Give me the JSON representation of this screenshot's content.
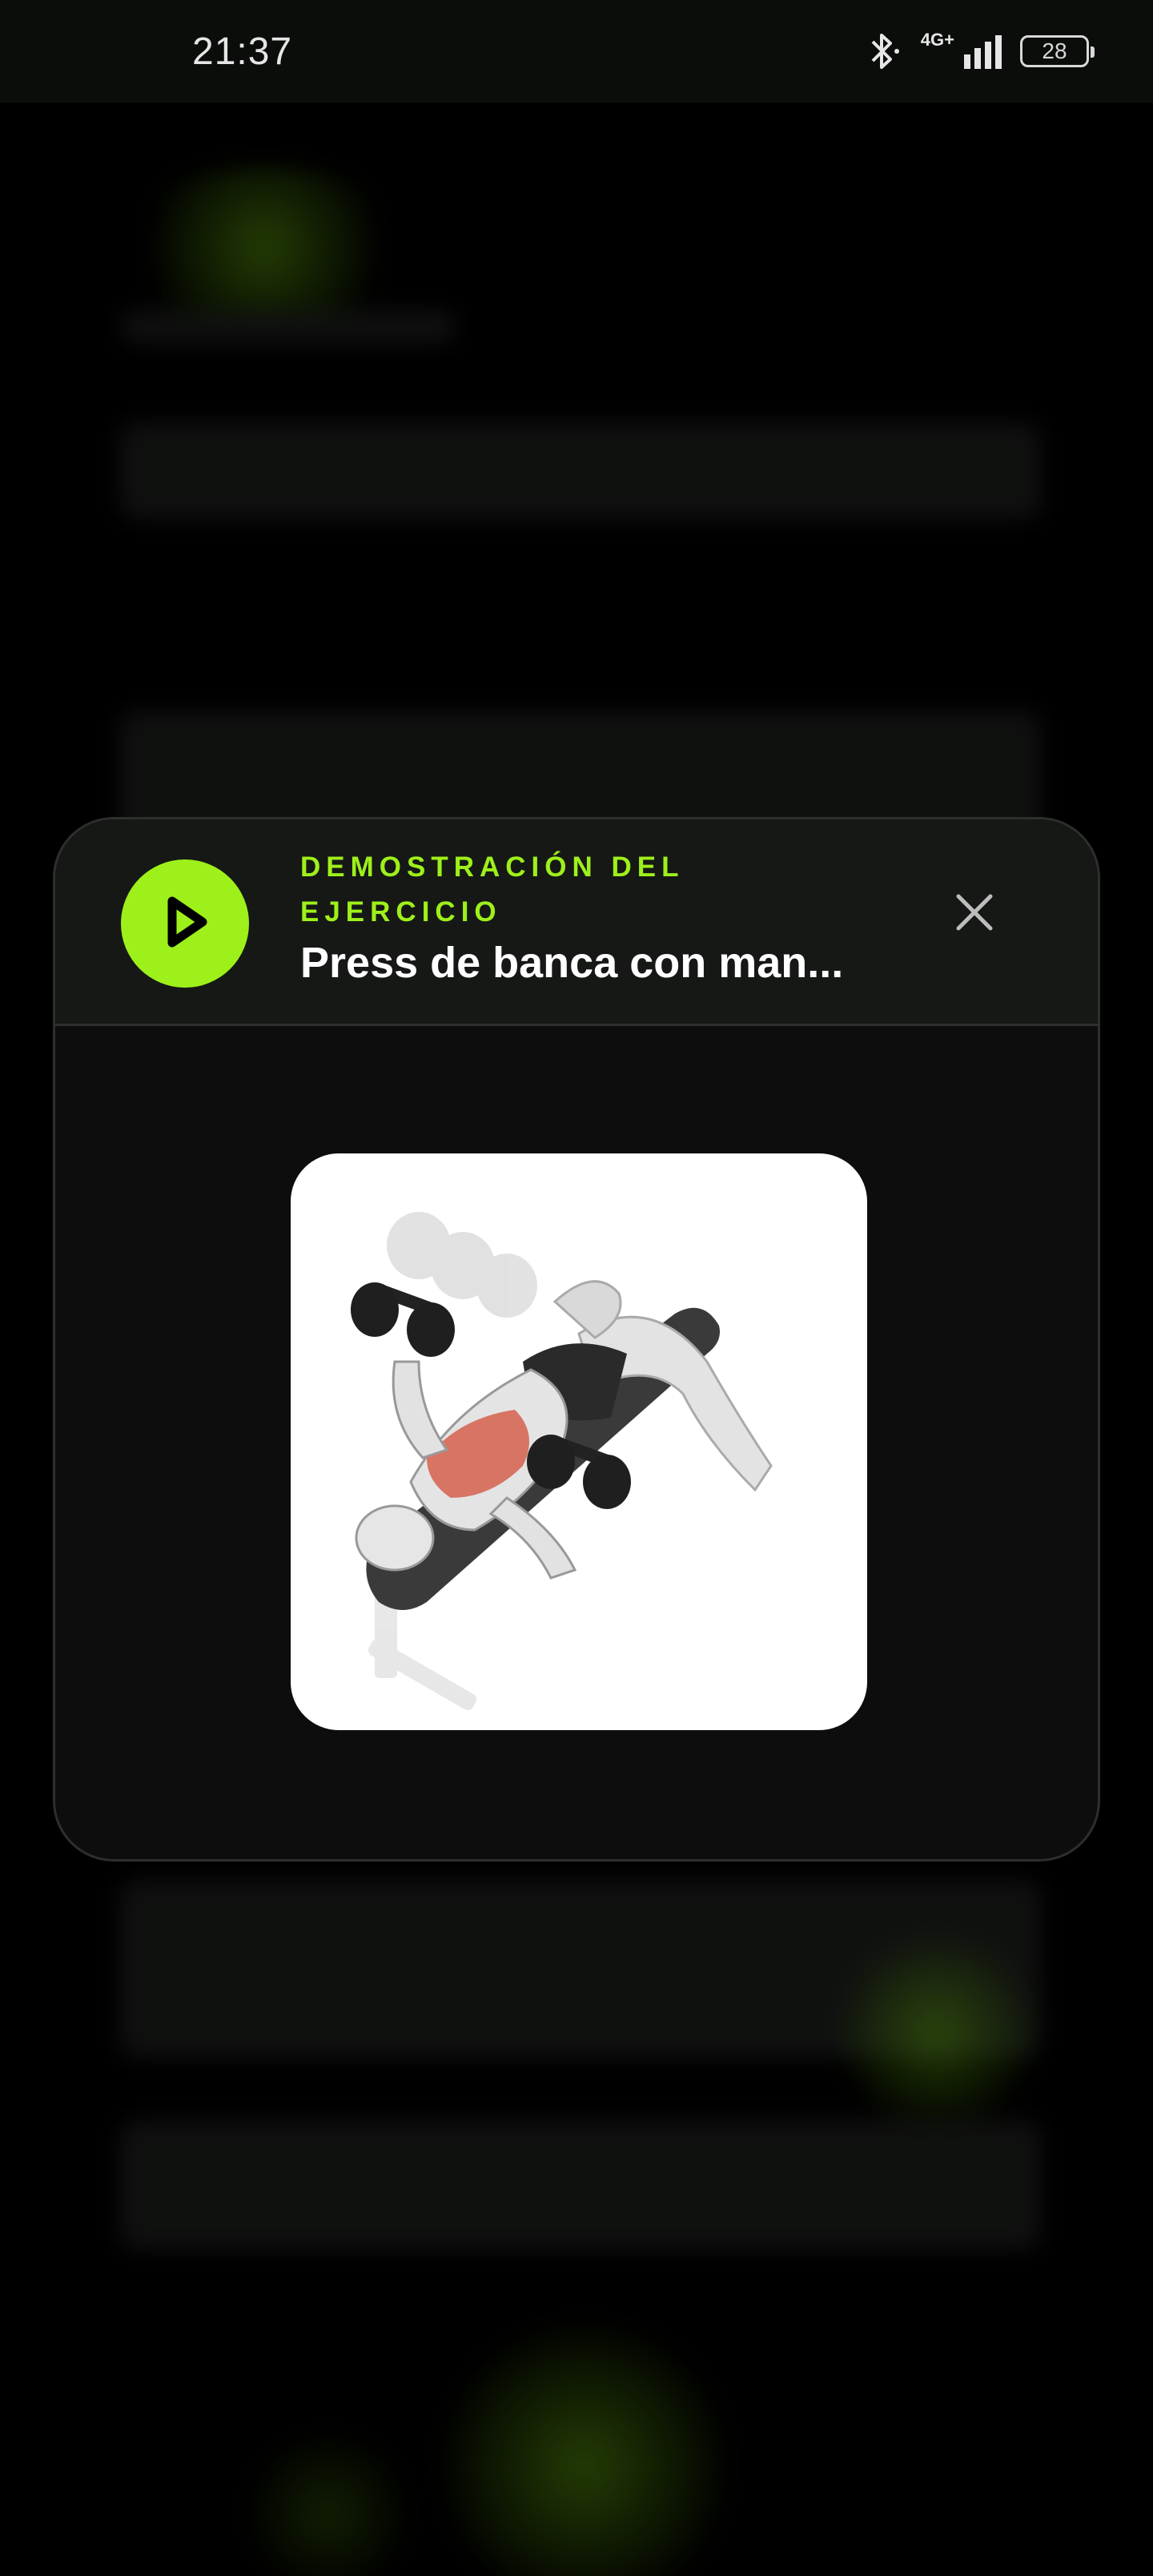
{
  "status_bar": {
    "time": "21:37",
    "network": "4G+",
    "battery": "28"
  },
  "modal": {
    "kicker": "DEMOSTRACIÓN DEL EJERCICIO",
    "title": "Press de banca con man...",
    "icons": {
      "play": "play-icon",
      "close": "close-icon"
    },
    "image": "exercise-illustration"
  },
  "colors": {
    "accent": "#9ef01a",
    "background": "#000000",
    "card": "#0c0d0c",
    "card_header": "#161816",
    "muscle_highlight": "#d6604e"
  }
}
